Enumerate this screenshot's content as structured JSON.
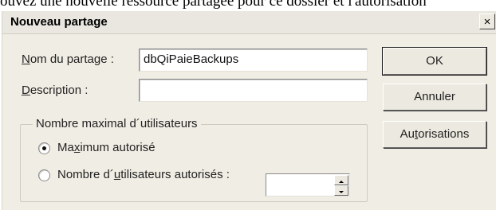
{
  "background_fragment": "ouvez une nouvelle ressource partagée pour ce dossier et l'autorisation",
  "dialog": {
    "title": "Nouveau partage",
    "close_glyph": "×"
  },
  "form": {
    "share_name_label": {
      "accel": "N",
      "rest": "om du partage :"
    },
    "share_name_value": "dbQiPaieBackups",
    "description_label": {
      "accel": "D",
      "rest": "escription :"
    },
    "description_value": "",
    "group_title": "Nombre maximal d´utilisateurs",
    "radio_max": {
      "before": "Ma",
      "accel": "x",
      "after": "imum autorisé",
      "selected": true
    },
    "radio_allowed": {
      "before": "Nombre d´",
      "accel": "u",
      "after": "tilisateurs autorisés :",
      "selected": false
    },
    "allowed_count_value": ""
  },
  "buttons": {
    "ok": "OK",
    "cancel": "Annuler",
    "permissions": {
      "before": "Au",
      "accel": "t",
      "after": "orisations"
    }
  }
}
